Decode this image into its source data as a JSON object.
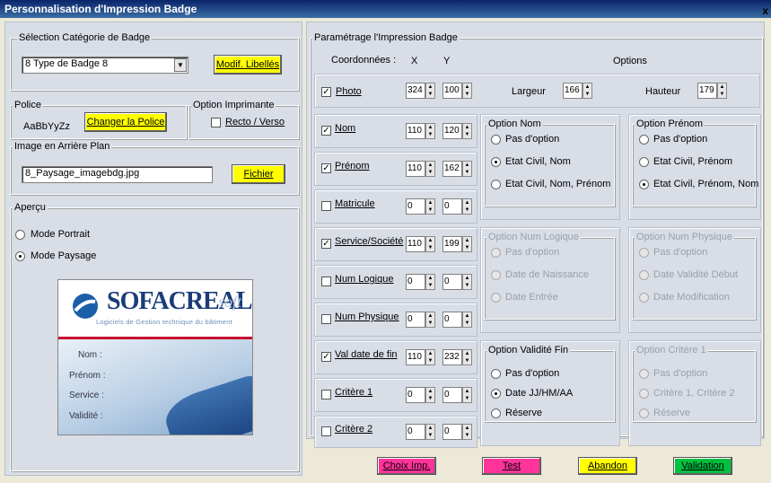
{
  "window": {
    "title": "Personnalisation d'Impression Badge",
    "close_glyph": "x"
  },
  "categorie": {
    "legend": "Sélection Catégorie de Badge",
    "value": "8 Type de Badge 8",
    "button": "Modif. Libellés"
  },
  "police": {
    "legend": "Police",
    "sample": "AaBbYyZz",
    "button": "Changer la Police"
  },
  "imprimante": {
    "legend": "Option Imprimante",
    "recto": "Recto / Verso"
  },
  "image": {
    "legend": "Image en Arrière Plan",
    "value": "8_Paysage_imagebdg.jpg",
    "button": "Fichier"
  },
  "apercu": {
    "legend": "Aperçu",
    "portrait": "Mode Portrait",
    "paysage": "Mode Paysage",
    "brand": "SOFACREAL",
    "brand_suffix": "soft",
    "tagline": "Logiciels de Gestion technique du bâtiment",
    "fields": [
      "Nom :",
      "Prénom :",
      "Service :",
      "Validité :"
    ]
  },
  "param": {
    "legend": "Paramétrage l'Impression Badge",
    "coord": "Coordonnées :",
    "x": "X",
    "y": "Y",
    "options": "Options"
  },
  "photo": {
    "label": "Photo",
    "x": "324",
    "y": "100",
    "largeur_label": "Largeur",
    "largeur": "166",
    "hauteur_label": "Hauteur",
    "hauteur": "179"
  },
  "fields": [
    {
      "label": "Nom",
      "checked": true,
      "x": "110",
      "y": "120"
    },
    {
      "label": "Prénom",
      "checked": true,
      "x": "110",
      "y": "162"
    },
    {
      "label": "Matricule",
      "checked": false,
      "x": "0",
      "y": "0"
    },
    {
      "label": "Service/Société",
      "checked": true,
      "x": "110",
      "y": "199"
    },
    {
      "label": "Num Logique",
      "checked": false,
      "x": "0",
      "y": "0"
    },
    {
      "label": "Num Physique",
      "checked": false,
      "x": "0",
      "y": "0"
    },
    {
      "label": "Val date de fin",
      "checked": true,
      "x": "110",
      "y": "232"
    },
    {
      "label": "Critère 1",
      "checked": false,
      "x": "0",
      "y": "0"
    },
    {
      "label": "Critère 2",
      "checked": false,
      "x": "0",
      "y": "0"
    }
  ],
  "opt_nom": {
    "legend": "Option Nom",
    "items": [
      "Pas d'option",
      "Etat Civil, Nom",
      "Etat Civil, Nom, Prénom"
    ]
  },
  "opt_prenom": {
    "legend": "Option Prénom",
    "items": [
      "Pas d'option",
      "Etat Civil, Prénom",
      "Etat Civil, Prénom, Nom"
    ]
  },
  "opt_numlog": {
    "legend": "Option Num Logique",
    "items": [
      "Pas d'option",
      "Date de Naissance",
      "Date Entrée"
    ]
  },
  "opt_numphy": {
    "legend": "Option Num Physique",
    "items": [
      "Pas d'option",
      "Date Validité Début",
      "Date Modification"
    ]
  },
  "opt_valid": {
    "legend": "Option Validité Fin",
    "items": [
      "Pas d'option",
      "Date JJ/HM/AA",
      "Réserve"
    ]
  },
  "opt_crit": {
    "legend": "Option Critère 1",
    "items": [
      "Pas d'option",
      "Critère 1, Critère 2",
      "Réserve"
    ]
  },
  "buttons": {
    "choix": "Choix Imp.",
    "test": "Test",
    "abandon": "Abandon",
    "validation": "Validation"
  },
  "colors": {
    "yellow": "#ffff00",
    "magenta": "#ff3399",
    "green": "#00c040",
    "panel": "#d8dde6"
  }
}
